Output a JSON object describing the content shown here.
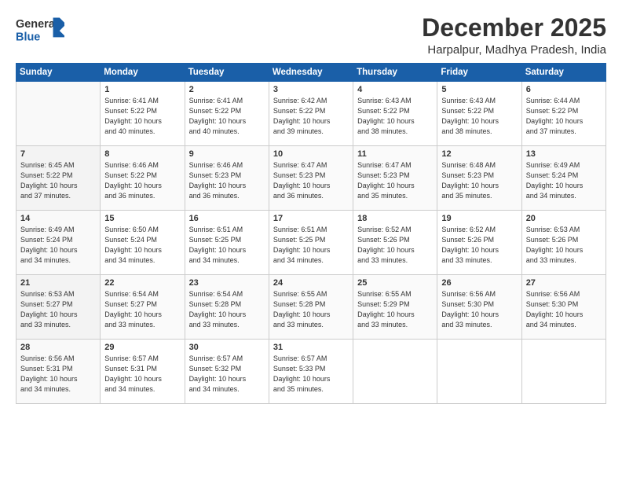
{
  "logo": {
    "text1": "General",
    "text2": "Blue"
  },
  "title": "December 2025",
  "location": "Harpalpur, Madhya Pradesh, India",
  "headers": [
    "Sunday",
    "Monday",
    "Tuesday",
    "Wednesday",
    "Thursday",
    "Friday",
    "Saturday"
  ],
  "weeks": [
    [
      {
        "day": "",
        "info": ""
      },
      {
        "day": "1",
        "info": "Sunrise: 6:41 AM\nSunset: 5:22 PM\nDaylight: 10 hours\nand 40 minutes."
      },
      {
        "day": "2",
        "info": "Sunrise: 6:41 AM\nSunset: 5:22 PM\nDaylight: 10 hours\nand 40 minutes."
      },
      {
        "day": "3",
        "info": "Sunrise: 6:42 AM\nSunset: 5:22 PM\nDaylight: 10 hours\nand 39 minutes."
      },
      {
        "day": "4",
        "info": "Sunrise: 6:43 AM\nSunset: 5:22 PM\nDaylight: 10 hours\nand 38 minutes."
      },
      {
        "day": "5",
        "info": "Sunrise: 6:43 AM\nSunset: 5:22 PM\nDaylight: 10 hours\nand 38 minutes."
      },
      {
        "day": "6",
        "info": "Sunrise: 6:44 AM\nSunset: 5:22 PM\nDaylight: 10 hours\nand 37 minutes."
      }
    ],
    [
      {
        "day": "7",
        "info": "Sunrise: 6:45 AM\nSunset: 5:22 PM\nDaylight: 10 hours\nand 37 minutes."
      },
      {
        "day": "8",
        "info": "Sunrise: 6:46 AM\nSunset: 5:22 PM\nDaylight: 10 hours\nand 36 minutes."
      },
      {
        "day": "9",
        "info": "Sunrise: 6:46 AM\nSunset: 5:23 PM\nDaylight: 10 hours\nand 36 minutes."
      },
      {
        "day": "10",
        "info": "Sunrise: 6:47 AM\nSunset: 5:23 PM\nDaylight: 10 hours\nand 36 minutes."
      },
      {
        "day": "11",
        "info": "Sunrise: 6:47 AM\nSunset: 5:23 PM\nDaylight: 10 hours\nand 35 minutes."
      },
      {
        "day": "12",
        "info": "Sunrise: 6:48 AM\nSunset: 5:23 PM\nDaylight: 10 hours\nand 35 minutes."
      },
      {
        "day": "13",
        "info": "Sunrise: 6:49 AM\nSunset: 5:24 PM\nDaylight: 10 hours\nand 34 minutes."
      }
    ],
    [
      {
        "day": "14",
        "info": "Sunrise: 6:49 AM\nSunset: 5:24 PM\nDaylight: 10 hours\nand 34 minutes."
      },
      {
        "day": "15",
        "info": "Sunrise: 6:50 AM\nSunset: 5:24 PM\nDaylight: 10 hours\nand 34 minutes."
      },
      {
        "day": "16",
        "info": "Sunrise: 6:51 AM\nSunset: 5:25 PM\nDaylight: 10 hours\nand 34 minutes."
      },
      {
        "day": "17",
        "info": "Sunrise: 6:51 AM\nSunset: 5:25 PM\nDaylight: 10 hours\nand 34 minutes."
      },
      {
        "day": "18",
        "info": "Sunrise: 6:52 AM\nSunset: 5:26 PM\nDaylight: 10 hours\nand 33 minutes."
      },
      {
        "day": "19",
        "info": "Sunrise: 6:52 AM\nSunset: 5:26 PM\nDaylight: 10 hours\nand 33 minutes."
      },
      {
        "day": "20",
        "info": "Sunrise: 6:53 AM\nSunset: 5:26 PM\nDaylight: 10 hours\nand 33 minutes."
      }
    ],
    [
      {
        "day": "21",
        "info": "Sunrise: 6:53 AM\nSunset: 5:27 PM\nDaylight: 10 hours\nand 33 minutes."
      },
      {
        "day": "22",
        "info": "Sunrise: 6:54 AM\nSunset: 5:27 PM\nDaylight: 10 hours\nand 33 minutes."
      },
      {
        "day": "23",
        "info": "Sunrise: 6:54 AM\nSunset: 5:28 PM\nDaylight: 10 hours\nand 33 minutes."
      },
      {
        "day": "24",
        "info": "Sunrise: 6:55 AM\nSunset: 5:28 PM\nDaylight: 10 hours\nand 33 minutes."
      },
      {
        "day": "25",
        "info": "Sunrise: 6:55 AM\nSunset: 5:29 PM\nDaylight: 10 hours\nand 33 minutes."
      },
      {
        "day": "26",
        "info": "Sunrise: 6:56 AM\nSunset: 5:30 PM\nDaylight: 10 hours\nand 33 minutes."
      },
      {
        "day": "27",
        "info": "Sunrise: 6:56 AM\nSunset: 5:30 PM\nDaylight: 10 hours\nand 34 minutes."
      }
    ],
    [
      {
        "day": "28",
        "info": "Sunrise: 6:56 AM\nSunset: 5:31 PM\nDaylight: 10 hours\nand 34 minutes."
      },
      {
        "day": "29",
        "info": "Sunrise: 6:57 AM\nSunset: 5:31 PM\nDaylight: 10 hours\nand 34 minutes."
      },
      {
        "day": "30",
        "info": "Sunrise: 6:57 AM\nSunset: 5:32 PM\nDaylight: 10 hours\nand 34 minutes."
      },
      {
        "day": "31",
        "info": "Sunrise: 6:57 AM\nSunset: 5:33 PM\nDaylight: 10 hours\nand 35 minutes."
      },
      {
        "day": "",
        "info": ""
      },
      {
        "day": "",
        "info": ""
      },
      {
        "day": "",
        "info": ""
      }
    ]
  ]
}
